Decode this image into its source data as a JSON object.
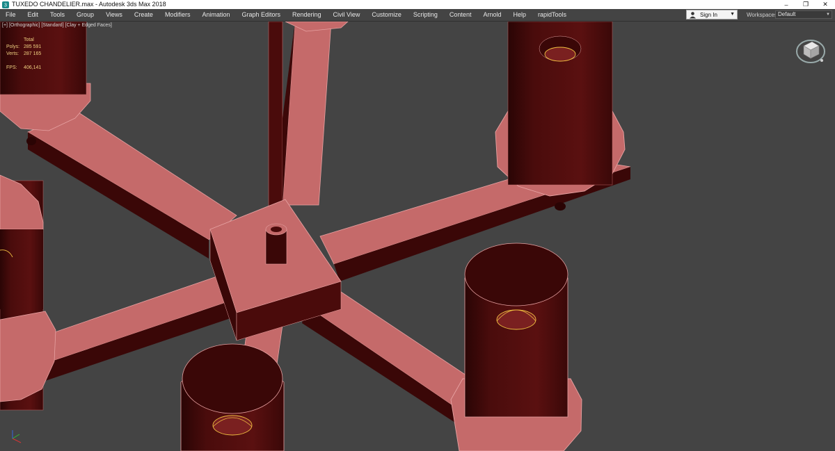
{
  "window": {
    "title": "TUXEDO CHANDELIER.max - Autodesk 3ds Max 2018",
    "minimize_glyph": "–",
    "restore_glyph": "❐",
    "close_glyph": "✕"
  },
  "menu": {
    "items": [
      "File",
      "Edit",
      "Tools",
      "Group",
      "Views",
      "Create",
      "Modifiers",
      "Animation",
      "Graph Editors",
      "Rendering",
      "Civil View",
      "Customize",
      "Scripting",
      "Content",
      "Arnold",
      "Help",
      "rapidTools"
    ]
  },
  "account": {
    "signin_label": "Sign In",
    "workspaces_label": "Workspaces:",
    "workspace_value": "Default"
  },
  "viewport": {
    "label_parts": [
      "[+]",
      "[Orthographic]",
      "[Standard]",
      "[Clay + Edged Faces]"
    ],
    "stats": {
      "header": "Total",
      "polys_label": "Polys:",
      "polys_value": "285 591",
      "verts_label": "Verts:",
      "verts_value": "287 165",
      "fps_label": "FPS:",
      "fps_value": "406,141"
    }
  },
  "icons": {
    "app": "3ds-max-icon",
    "user": "user-icon",
    "viewcube": "viewcube-icon",
    "axis": "axis-gizmo-icon"
  },
  "colors": {
    "viewport_bg": "#444444",
    "clay_face": "#c46c6c",
    "clay_dark": "#3c0a0a",
    "edge": "#e8a4a4",
    "stats_text": "#f0d080"
  }
}
